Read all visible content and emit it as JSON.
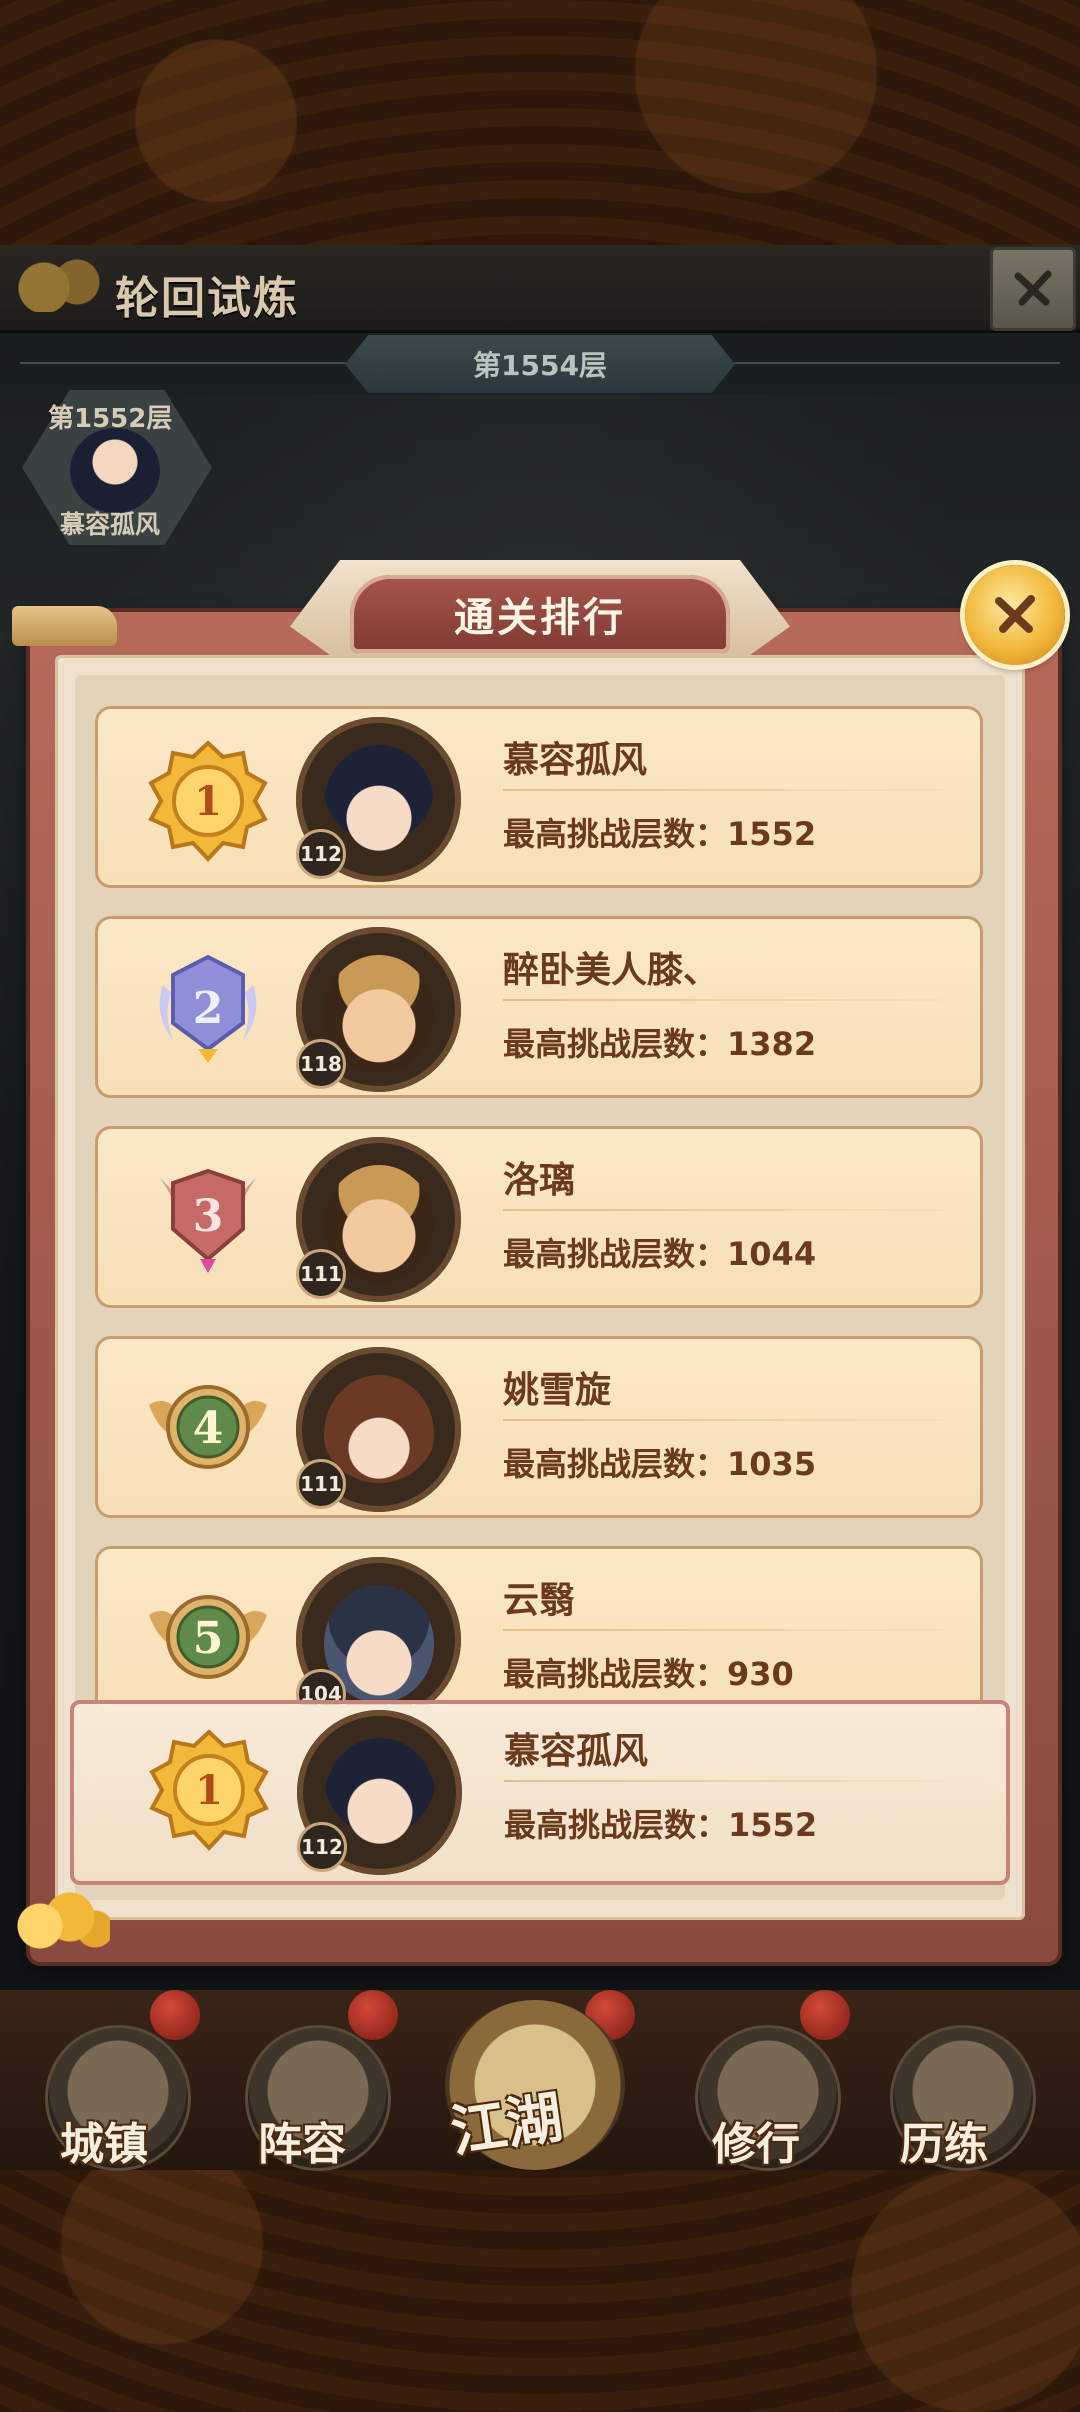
{
  "window": {
    "title": "轮回试炼",
    "current_floor": "第1554层",
    "previous_floor": {
      "label": "第1552层",
      "player": "慕容孤风"
    }
  },
  "modal": {
    "title": "通关排行",
    "score_label": "最高挑战层数：",
    "rows": [
      {
        "rank": "1",
        "level": "112",
        "name": "慕容孤风",
        "score": "1552",
        "badge": "gold",
        "avatar": "hero-black-hair"
      },
      {
        "rank": "2",
        "level": "118",
        "name": "醉卧美人膝、",
        "score": "1382",
        "badge": "silver",
        "avatar": "hero-sunglasses"
      },
      {
        "rank": "3",
        "level": "111",
        "name": "洛璃",
        "score": "1044",
        "badge": "bronze",
        "avatar": "hero-sunglasses"
      },
      {
        "rank": "4",
        "level": "111",
        "name": "姚雪旋",
        "score": "1035",
        "badge": "green",
        "avatar": "hero-brown-hair"
      },
      {
        "rank": "5",
        "level": "104",
        "name": "云翳",
        "score": "930",
        "badge": "green",
        "avatar": "hero-blue-eyes"
      }
    ],
    "self": {
      "rank": "1",
      "level": "112",
      "name": "慕容孤风",
      "score": "1552",
      "badge": "gold",
      "avatar": "hero-black-hair"
    }
  },
  "bottom_nav": {
    "items": [
      {
        "label": "城镇",
        "icon": "town-icon"
      },
      {
        "label": "阵容",
        "icon": "lineup-icon"
      },
      {
        "label": "江湖",
        "icon": "jianghu-scroll-icon"
      },
      {
        "label": "修行",
        "icon": "cultivation-icon"
      },
      {
        "label": "历练",
        "icon": "training-icon"
      }
    ]
  },
  "colors": {
    "gold": "#f2b83a",
    "silver": "#8f8fd8",
    "bronze": "#c56a66",
    "green": "#5f8a4a",
    "text_brown": "#6b3a1c",
    "modal_frame": "#a05a4e"
  }
}
